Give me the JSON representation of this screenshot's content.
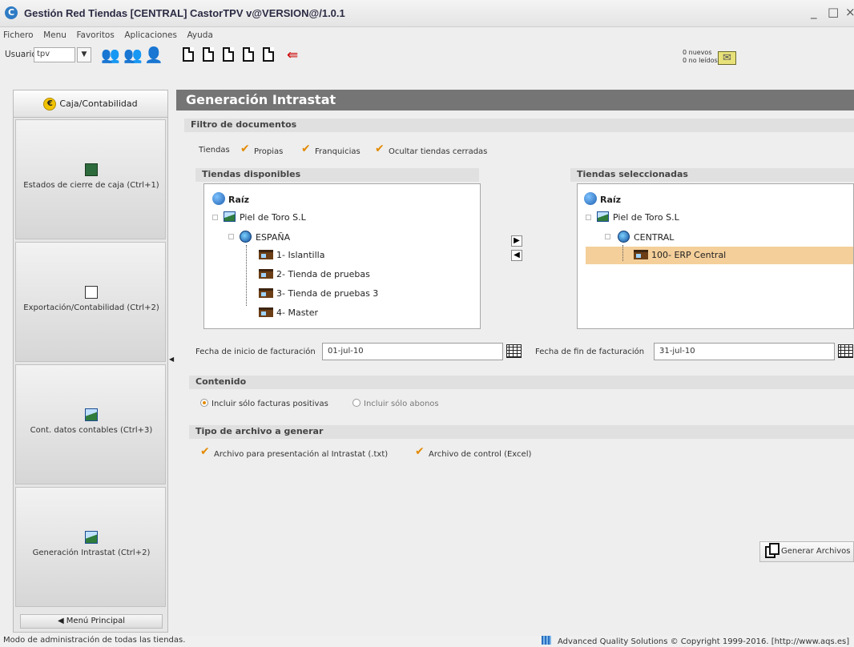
{
  "window": {
    "title": "Gestión Red Tiendas [CENTRAL] CastorTPV v@VERSION@/1.0.1",
    "minimize": "_",
    "maximize": "□",
    "close": "×"
  },
  "menubar": [
    "Fichero",
    "Menu",
    "Favoritos",
    "Aplicaciones",
    "Ayuda"
  ],
  "toolbar": {
    "user_label": "Usuario:",
    "user_value": "tpv",
    "messages_line1": "0 nuevos",
    "messages_line2": "0 no leídos"
  },
  "sidebar": {
    "header": "Caja/Contabilidad",
    "buttons": [
      {
        "label": "Estados de cierre de caja (Ctrl+1)"
      },
      {
        "label": "Exportación/Contabilidad (Ctrl+2)"
      },
      {
        "label": "Cont. datos contables (Ctrl+3)"
      },
      {
        "label": "Generación Intrastat (Ctrl+2)"
      }
    ],
    "footer": "◀ Menú Principal"
  },
  "main": {
    "title": "Generación Intrastat",
    "filter": {
      "section": "Filtro de documentos",
      "stores_label": "Tiendas",
      "own": "Propias",
      "franchises": "Franquicias",
      "hide_closed": "Ocultar tiendas cerradas"
    },
    "available": {
      "title": "Tiendas disponibles",
      "root": "Raíz",
      "company": "Piel de Toro S.L",
      "country": "ESPAÑA",
      "stores": [
        "1- Islantilla",
        "2- Tienda de pruebas",
        "3- Tienda de pruebas 3",
        "4- Master"
      ]
    },
    "selected": {
      "title": "Tiendas seleccionadas",
      "root": "Raíz",
      "company": "Piel de Toro S.L",
      "group": "CENTRAL",
      "store": "100- ERP Central"
    },
    "dates": {
      "start_label": "Fecha de inicio de facturación",
      "start_value": "01-jul-10",
      "end_label": "Fecha de fin de facturación",
      "end_value": "31-jul-10"
    },
    "content": {
      "section": "Contenido",
      "opt_positive": "Incluir sólo facturas positivas",
      "opt_credit": "Incluir sólo abonos"
    },
    "file_type": {
      "section": "Tipo de archivo a generar",
      "opt_intrastat": "Archivo para presentación al Intrastat (.txt)",
      "opt_control": "Archivo de control (Excel)"
    },
    "generate_button": "Generar Archivos"
  },
  "statusbar": {
    "left": "Modo de administración de todas las tiendas.",
    "right": "Advanced Quality Solutions © Copyright 1999-2016. [http://www.aqs.es]"
  },
  "colors": {
    "accent": "#e38a00",
    "title_bar": "#757575",
    "selection": "#f4cf9a"
  }
}
